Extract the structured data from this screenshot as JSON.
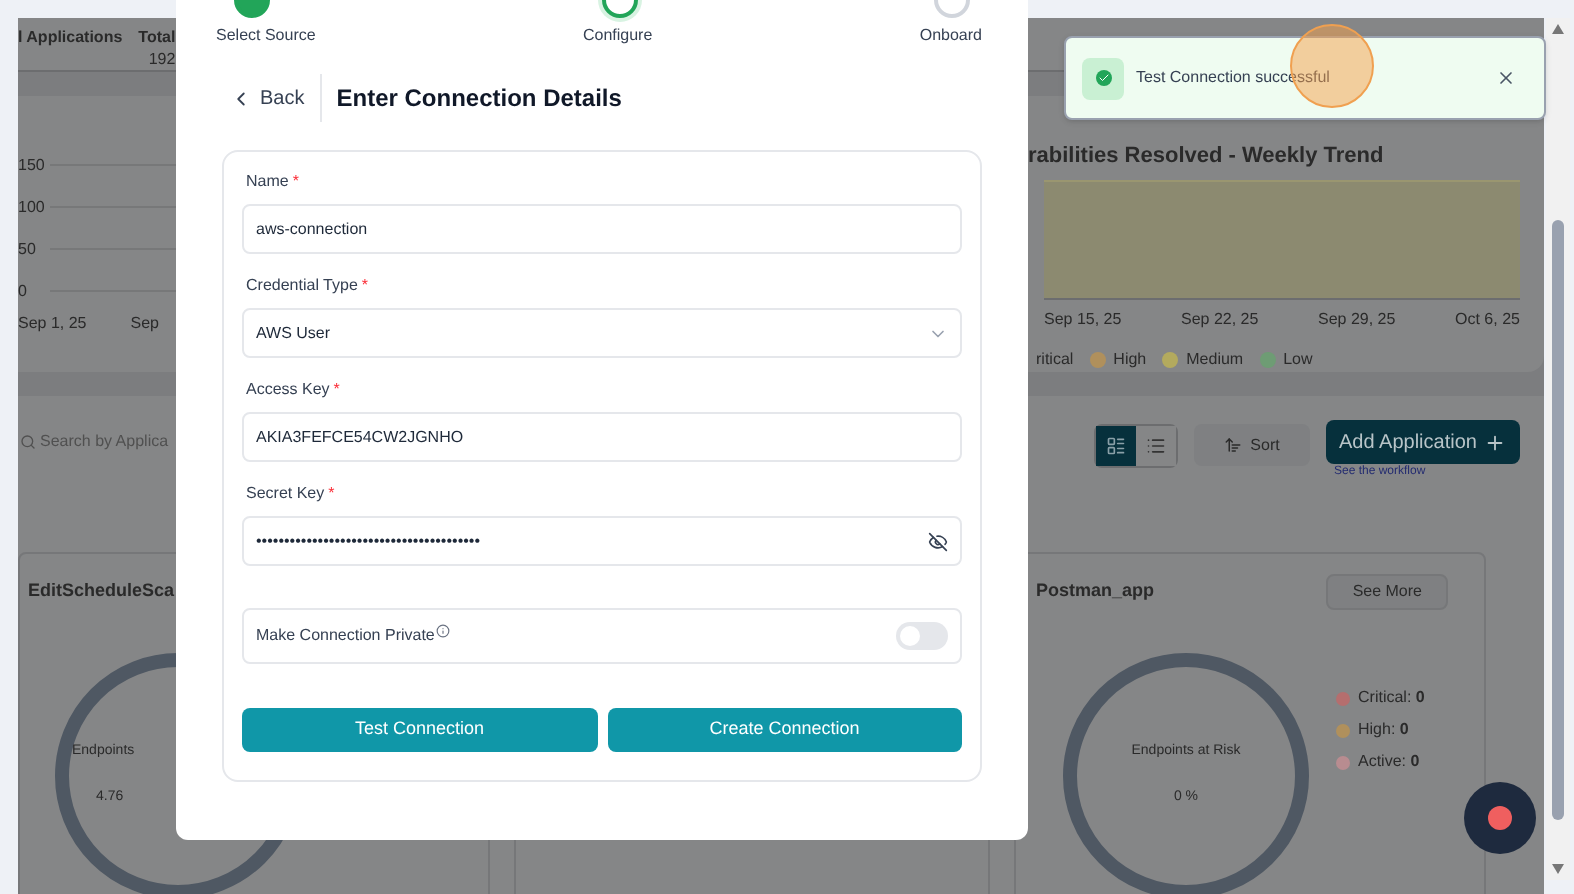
{
  "dashboard": {
    "stats": [
      {
        "label": "l Applications"
      },
      {
        "label": "Total",
        "value": "192"
      }
    ],
    "left_chart": {
      "y_ticks": [
        "150",
        "100",
        "50",
        "0"
      ],
      "x_labels": [
        "Sep 1, 25",
        "Sep"
      ]
    },
    "right_chart": {
      "title": "rabilities Resolved - Weekly Trend",
      "x_labels": [
        "Sep 15, 25",
        "Sep 22, 25",
        "Sep 29, 25",
        "Oct 6, 25"
      ],
      "legend": [
        {
          "label": "ritical"
        },
        {
          "label": "High",
          "color": "#b0905c"
        },
        {
          "label": "Medium",
          "color": "#b3aa5e"
        },
        {
          "label": "Low",
          "color": "#6e9c74"
        }
      ]
    },
    "apps": {
      "search_placeholder": "Search by Applica",
      "views": [
        {
          "kind": "grid",
          "selected": true
        },
        {
          "kind": "list",
          "selected": false
        }
      ],
      "sort": "Sort",
      "add": "Add Application",
      "workflow_link": "See the workflow",
      "cards": [
        {
          "title": "EditScheduleSca",
          "gauge_label": "Endpoints",
          "gauge_value": "4.76"
        },
        {
          "title": "Postman_app",
          "button": "See More",
          "gauge_label": "Endpoints at Risk",
          "gauge_value": "0 %",
          "stats": [
            {
              "label": "Critical:",
              "value": "0",
              "color": "#b56e6e"
            },
            {
              "label": "High:",
              "value": "0",
              "color": "#b0905c"
            },
            {
              "label": "Active:",
              "value": "0",
              "color": "#b88c90"
            }
          ]
        }
      ]
    }
  },
  "modal": {
    "steps": [
      {
        "label": "Select Source",
        "completed": true,
        "selected": false
      },
      {
        "label": "Configure",
        "completed": false,
        "selected": true
      },
      {
        "label": "Onboard",
        "completed": false,
        "selected": false
      }
    ],
    "back": "Back",
    "title": "Enter Connection Details",
    "fields": [
      {
        "kind": "text",
        "label": "Name",
        "required_mark": "*",
        "value": "aws-connection"
      },
      {
        "kind": "select",
        "label": "Credential Type",
        "required_mark": "*",
        "value": "AWS User"
      },
      {
        "kind": "text",
        "label": "Access Key",
        "required_mark": "*",
        "value": "AKIA3FEFCE54CW2JGNHO"
      },
      {
        "kind": "password",
        "label": "Secret Key",
        "required_mark": "*",
        "value": "••••••••••••••••••••••••••••••••••••••••"
      }
    ],
    "private_toggle": {
      "label": "Make Connection Private",
      "on": false
    },
    "buttons": [
      "Test Connection",
      "Create Connection"
    ]
  },
  "toast": {
    "message": "Test Connection successful"
  }
}
